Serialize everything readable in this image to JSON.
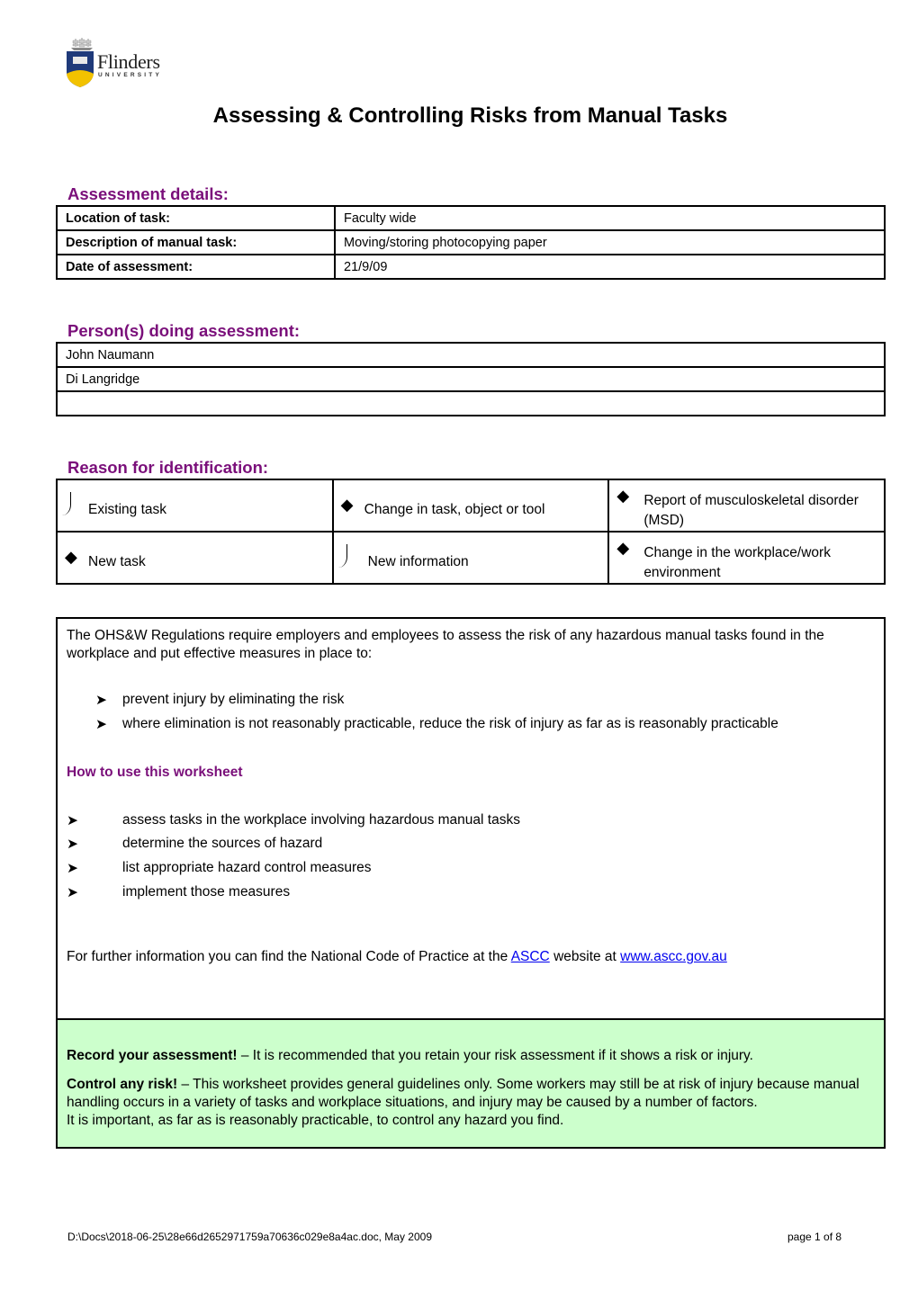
{
  "logo": {
    "name": "Flinders",
    "subtitle": "UNIVERSITY"
  },
  "title": "Assessing & Controlling Risks from Manual Tasks",
  "assessment_details": {
    "heading": "Assessment details:",
    "rows": [
      {
        "label": "Location of task:",
        "value": "Faculty wide"
      },
      {
        "label": "Description of manual task:",
        "value": "Moving/storing photocopying paper"
      },
      {
        "label": "Date of assessment:",
        "value": "21/9/09"
      }
    ]
  },
  "persons": {
    "heading": "Person(s) doing assessment:",
    "rows": [
      "John Naumann",
      "Di Langridge",
      ""
    ]
  },
  "reason": {
    "heading": "Reason for identification:",
    "rows": [
      [
        {
          "mark": "checked-hook",
          "label": "Existing task"
        },
        {
          "mark": "diamond",
          "label": "Change in task, object or tool"
        },
        {
          "mark": "diamond",
          "label": "Report of musculoskeletal disorder (MSD)"
        }
      ],
      [
        {
          "mark": "diamond",
          "label": "New task"
        },
        {
          "mark": "checked-hook",
          "label": "New information"
        },
        {
          "mark": "diamond",
          "label": "Change in the workplace/work environment"
        }
      ]
    ]
  },
  "info": {
    "intro": "The OHS&W Regulations require employers and employees to assess the risk of any hazardous manual tasks found in the workplace and put effective measures in place to:",
    "measures": [
      "prevent injury by eliminating the risk",
      "where elimination is not reasonably practicable, reduce the risk of injury as far as is reasonably practicable"
    ],
    "howto_heading": "How to use this worksheet",
    "howto_steps": [
      "assess tasks in the workplace involving hazardous manual tasks",
      "determine the sources of hazard",
      "list appropriate hazard control measures",
      "implement those measures"
    ],
    "further_prefix": "For further information you can find the National Code of Practice at the ",
    "further_link1": "ASCC",
    "further_middle": " website at ",
    "further_link2": "www.ascc.gov.au"
  },
  "notice": {
    "record_bold": "Record your assessment!",
    "record_text": " –  It is recommended that you retain your risk assessment if it shows a risk or injury.",
    "control_bold": "Control any risk!",
    "control_text": " – This worksheet provides general guidelines only. Some workers may still be at risk of injury because manual handling occurs in a variety of tasks and workplace situations, and injury may be caused by a number of factors.",
    "important": "It is important, as far as is reasonably practicable, to control any hazard you find."
  },
  "footer": {
    "path": "D:\\Docs\\2018-06-25\\28e66d2652971759a70636c029e8a4ac.doc, May 2009",
    "page": "page 1 of 8"
  },
  "colors": {
    "heading_purple": "#7a0f7a",
    "notice_green": "#ccffcc",
    "link_blue": "#0000ee"
  }
}
